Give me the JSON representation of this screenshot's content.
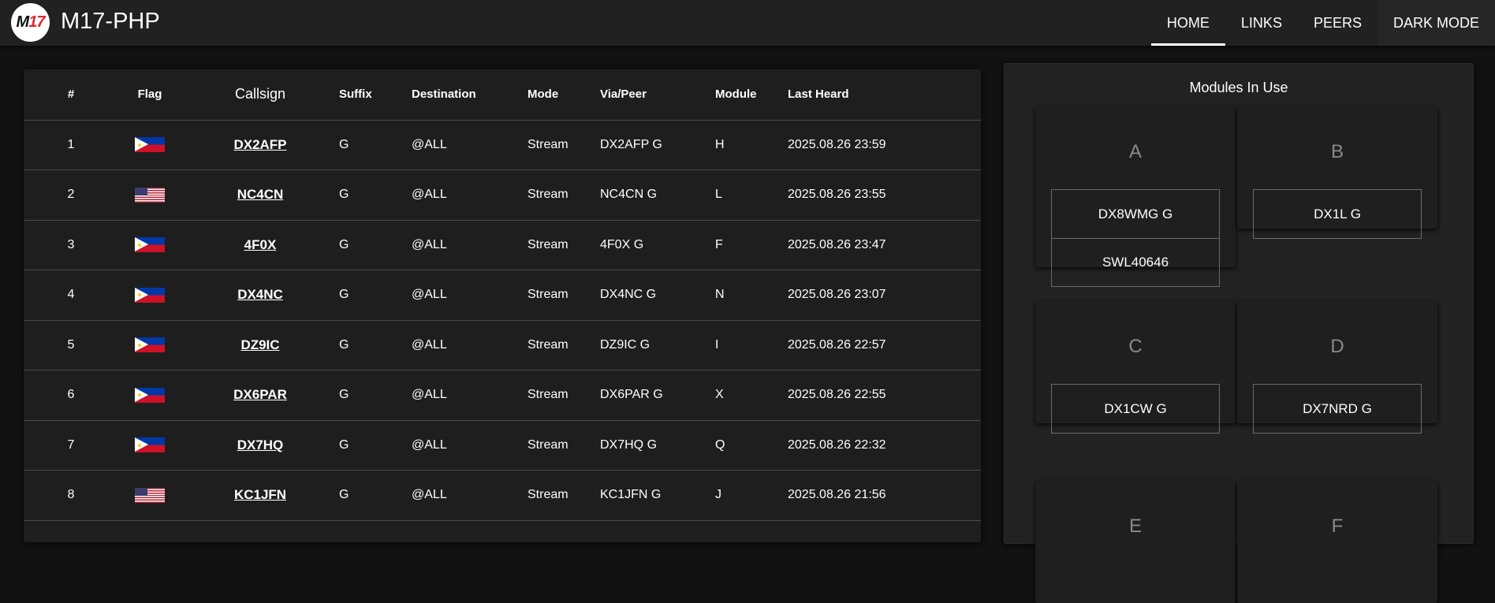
{
  "app": {
    "logo_m": "M",
    "logo_n": "17",
    "title": "M17-PHP"
  },
  "nav": [
    {
      "label": "HOME",
      "active": true
    },
    {
      "label": "LINKS",
      "active": false
    },
    {
      "label": "PEERS",
      "active": false
    },
    {
      "label": "DARK MODE",
      "active": false
    }
  ],
  "table": {
    "headers": {
      "num": "#",
      "flag": "Flag",
      "callsign": "Callsign",
      "suffix": "Suffix",
      "destination": "Destination",
      "mode": "Mode",
      "via": "Via/Peer",
      "module": "Module",
      "last_heard": "Last Heard"
    },
    "rows": [
      {
        "num": "1",
        "flag": "ph-flag-icon",
        "callsign": "DX2AFP",
        "suffix": "G",
        "destination": "@ALL",
        "mode": "Stream",
        "via": "DX2AFP G",
        "module": "H",
        "last_heard": "2025.08.26 23:59"
      },
      {
        "num": "2",
        "flag": "us-flag-icon",
        "callsign": "NC4CN",
        "suffix": "G",
        "destination": "@ALL",
        "mode": "Stream",
        "via": "NC4CN G",
        "module": "L",
        "last_heard": "2025.08.26 23:55"
      },
      {
        "num": "3",
        "flag": "ph-flag-icon",
        "callsign": "4F0X",
        "suffix": "G",
        "destination": "@ALL",
        "mode": "Stream",
        "via": "4F0X G",
        "module": "F",
        "last_heard": "2025.08.26 23:47"
      },
      {
        "num": "4",
        "flag": "ph-flag-icon",
        "callsign": "DX4NC",
        "suffix": "G",
        "destination": "@ALL",
        "mode": "Stream",
        "via": "DX4NC G",
        "module": "N",
        "last_heard": "2025.08.26 23:07"
      },
      {
        "num": "5",
        "flag": "ph-flag-icon",
        "callsign": "DZ9IC",
        "suffix": "G",
        "destination": "@ALL",
        "mode": "Stream",
        "via": "DZ9IC G",
        "module": "I",
        "last_heard": "2025.08.26 22:57"
      },
      {
        "num": "6",
        "flag": "ph-flag-icon",
        "callsign": "DX6PAR",
        "suffix": "G",
        "destination": "@ALL",
        "mode": "Stream",
        "via": "DX6PAR G",
        "module": "X",
        "last_heard": "2025.08.26 22:55"
      },
      {
        "num": "7",
        "flag": "ph-flag-icon",
        "callsign": "DX7HQ",
        "suffix": "G",
        "destination": "@ALL",
        "mode": "Stream",
        "via": "DX7HQ G",
        "module": "Q",
        "last_heard": "2025.08.26 22:32"
      },
      {
        "num": "8",
        "flag": "us-flag-icon",
        "callsign": "KC1JFN",
        "suffix": "G",
        "destination": "@ALL",
        "mode": "Stream",
        "via": "KC1JFN G",
        "module": "J",
        "last_heard": "2025.08.26 21:56"
      }
    ]
  },
  "modules": {
    "title": "Modules In Use",
    "items": [
      {
        "letter": "A",
        "peers": [
          "DX8WMG G",
          "SWL40646"
        ]
      },
      {
        "letter": "B",
        "peers": [
          "DX1L G"
        ]
      },
      {
        "letter": "C",
        "peers": [
          "DX1CW G"
        ]
      },
      {
        "letter": "D",
        "peers": [
          "DX7NRD G"
        ]
      },
      {
        "letter": "E",
        "peers": []
      },
      {
        "letter": "F",
        "peers": []
      }
    ]
  },
  "colors": {
    "background": "#121212",
    "surface": "#1e1e1e",
    "topbar": "#212121",
    "logo_accent": "#e3262c",
    "module_letter": "#8a8a8a"
  }
}
